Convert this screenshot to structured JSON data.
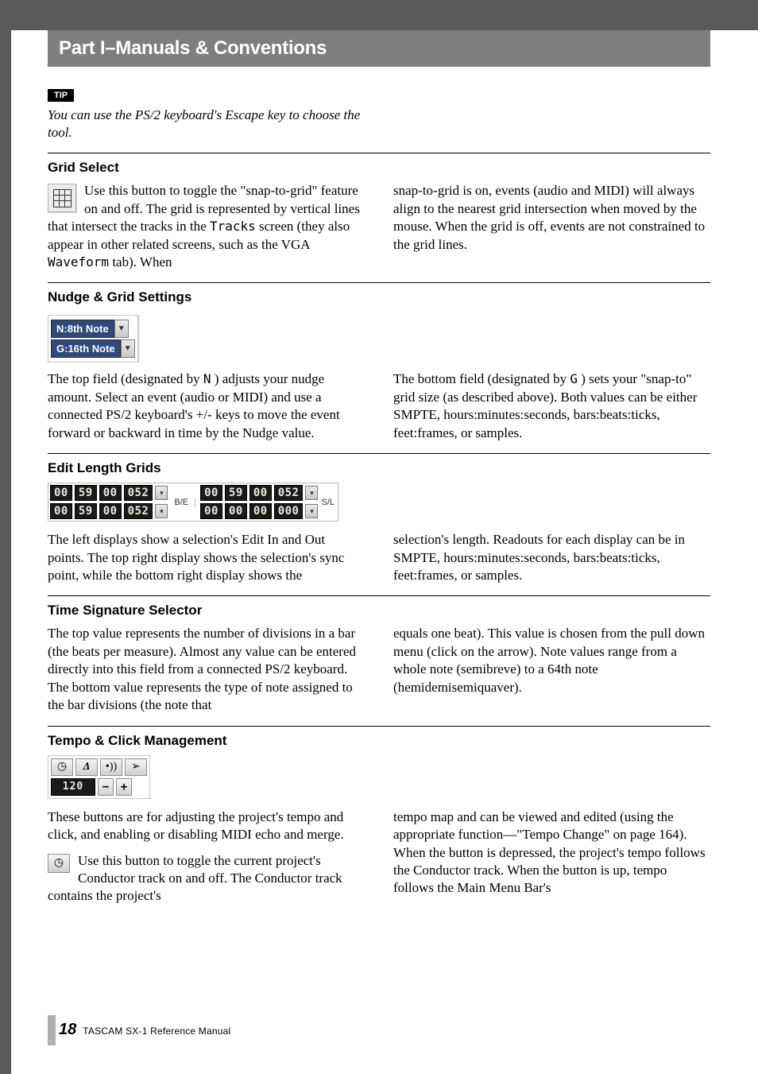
{
  "header": {
    "title": "Part I–Manuals & Conventions"
  },
  "tip": {
    "badge": "TIP",
    "text": "You can use the PS/2 keyboard's Escape key to choose the tool."
  },
  "sections": {
    "grid_select": {
      "heading": "Grid Select",
      "left": {
        "p1a": "Use this button to toggle the \"snap-to-grid\" feature on and off. The grid is represented by vertical lines that intersect the tracks in the ",
        "mono1": "Tracks",
        "p1b": " screen (they also appear in other related screens, such as the VGA ",
        "mono2": "Waveform",
        "p1c": " tab). When"
      },
      "right": "snap-to-grid is on, events (audio and MIDI) will always align to the nearest grid intersection when moved by the mouse. When the grid is off, events are not constrained to the grid lines."
    },
    "nudge": {
      "heading": "Nudge & Grid Settings",
      "widget": {
        "n": "N:8th Note",
        "g": "G:16th Note"
      },
      "left": {
        "a": "The top field (designated by ",
        "mono": "N",
        "b": ") adjusts your nudge amount. Select an event (audio or MIDI) and use a connected PS/2 keyboard's +/- keys to move the event forward or backward in time by the Nudge value."
      },
      "right": {
        "a": "The bottom field (designated by ",
        "mono": "G",
        "b": ") sets your \"snap-to\" grid size (as described above). Both values can be either SMPTE, hours:minutes:seconds, bars:beats:ticks, feet:frames, or samples."
      }
    },
    "editlen": {
      "heading": "Edit Length Grids",
      "widget": {
        "left": {
          "row1": [
            "00",
            "59",
            "00",
            "052"
          ],
          "row2": [
            "00",
            "59",
            "00",
            "052"
          ]
        },
        "mid_label": "B/E",
        "right": {
          "row1": [
            "00",
            "59",
            "00",
            "052"
          ],
          "row2": [
            "00",
            "00",
            "00",
            "000"
          ]
        },
        "end_label": "S/L"
      },
      "left": "The left displays show a selection's Edit In and Out points. The top right display shows the selection's sync point, while the bottom right display shows the",
      "right": "selection's length. Readouts for each display can be in SMPTE, hours:minutes:seconds, bars:beats:ticks, feet:frames, or samples."
    },
    "timesig": {
      "heading": "Time Signature Selector",
      "left": "The top value represents the number of divisions in a bar (the beats per measure). Almost any value can be entered directly into this field from a connected PS/2 keyboard. The bottom value represents the type of note assigned to the bar divisions (the note that",
      "right": "equals one beat). This value is chosen from the pull down menu (click on the arrow). Note values range from a whole note (semibreve) to a 64th note (hemidemisemiquaver)."
    },
    "tempo": {
      "heading": "Tempo & Click Management",
      "widget": {
        "bpm": "120",
        "minus": "−",
        "plus": "+"
      },
      "left": {
        "p1": "These buttons are for adjusting the project's tempo and click, and enabling or disabling MIDI echo and merge.",
        "p2": "Use this button to toggle the current project's Conductor track on and off. The Conductor track contains the project's"
      },
      "right": "tempo map and can be viewed and edited (using the appropriate function—\"Tempo Change\" on page 164). When the button is depressed, the project's tempo follows the Conductor track. When the button is up, tempo follows the Main Menu Bar's"
    }
  },
  "footer": {
    "page": "18",
    "text": "TASCAM SX-1 Reference Manual"
  }
}
